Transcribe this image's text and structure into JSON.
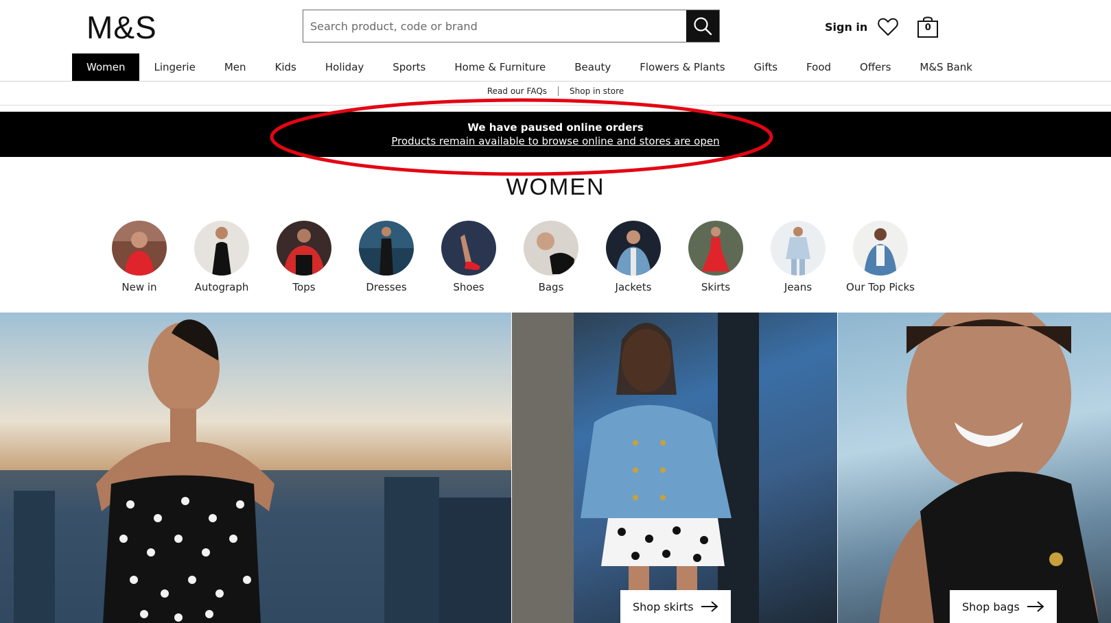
{
  "header": {
    "logo": "M&S",
    "search_placeholder": "Search product, code or brand",
    "sign_in": "Sign in",
    "bag_count": "0"
  },
  "nav": {
    "items": [
      {
        "label": "Women",
        "active": true
      },
      {
        "label": "Lingerie"
      },
      {
        "label": "Men"
      },
      {
        "label": "Kids"
      },
      {
        "label": "Holiday"
      },
      {
        "label": "Sports"
      },
      {
        "label": "Home & Furniture"
      },
      {
        "label": "Beauty"
      },
      {
        "label": "Flowers & Plants"
      },
      {
        "label": "Gifts"
      },
      {
        "label": "Food"
      },
      {
        "label": "Offers"
      },
      {
        "label": "M&S Bank"
      }
    ]
  },
  "sublinks": {
    "faqs": "Read our FAQs",
    "shop_in_store": "Shop in store"
  },
  "banner": {
    "title": "We have paused online orders",
    "link": "Products remain available to browse online and stores are open"
  },
  "page": {
    "heading": "WOMEN"
  },
  "categories": [
    {
      "label": "New in",
      "icon": "new-in-thumbnail"
    },
    {
      "label": "Autograph",
      "icon": "autograph-thumbnail"
    },
    {
      "label": "Tops",
      "icon": "tops-thumbnail"
    },
    {
      "label": "Dresses",
      "icon": "dresses-thumbnail"
    },
    {
      "label": "Shoes",
      "icon": "shoes-thumbnail"
    },
    {
      "label": "Bags",
      "icon": "bags-thumbnail"
    },
    {
      "label": "Jackets",
      "icon": "jackets-thumbnail"
    },
    {
      "label": "Skirts",
      "icon": "skirts-thumbnail"
    },
    {
      "label": "Jeans",
      "icon": "jeans-thumbnail"
    },
    {
      "label": "Our Top Picks",
      "icon": "top-picks-thumbnail"
    }
  ],
  "tiles": {
    "skirts_cta": "Shop skirts",
    "bags_cta": "Shop bags"
  },
  "colors": {
    "banner_bg": "#000000",
    "annotation": "#e30613",
    "nav_active_bg": "#000000"
  }
}
